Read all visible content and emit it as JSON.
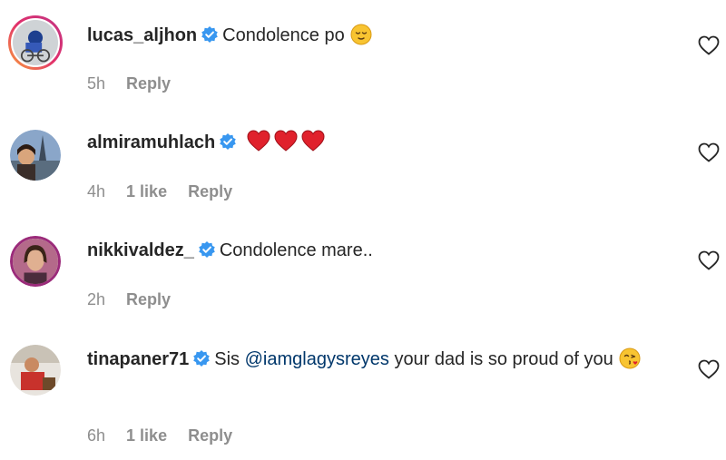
{
  "comments": [
    {
      "username": "lucas_aljhon",
      "text": "Condolence po",
      "time": "5h",
      "likes": "",
      "reply_label": "Reply",
      "emoji": "relieved-face"
    },
    {
      "username": "almiramuhlach",
      "text": "",
      "time": "4h",
      "likes": "1 like",
      "reply_label": "Reply",
      "emoji": "three-red-hearts"
    },
    {
      "username": "nikkivaldez_",
      "text": "Condolence mare..",
      "time": "2h",
      "likes": "",
      "reply_label": "Reply"
    },
    {
      "username": "tinapaner71",
      "text_before": "Sis",
      "mention": "@iamglagysreyes",
      "text_after": "your dad is so proud of you",
      "time": "6h",
      "likes": "1 like",
      "reply_label": "Reply",
      "emoji": "face-blowing-kiss"
    }
  ],
  "colors": {
    "verified": "#3897f0",
    "mention": "#00376b",
    "meta": "#8e8e8e",
    "heart": "#e0212c"
  },
  "icons": {
    "verified": "verified-badge-icon",
    "like": "heart-outline-icon"
  }
}
